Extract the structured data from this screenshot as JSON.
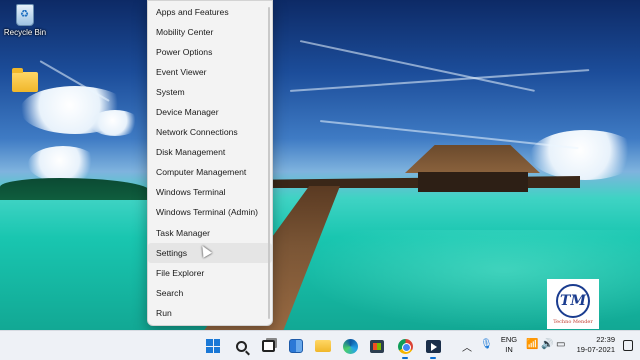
{
  "desktop": {
    "icons": [
      {
        "label": "Recycle Bin",
        "icon": "recycle-bin-icon"
      },
      {
        "label": "",
        "icon": "folder-icon"
      }
    ]
  },
  "winx_menu": {
    "items": [
      "Apps and Features",
      "Mobility Center",
      "Power Options",
      "Event Viewer",
      "System",
      "Device Manager",
      "Network Connections",
      "Disk Management",
      "Computer Management",
      "Windows Terminal",
      "Windows Terminal (Admin)",
      "Task Manager",
      "Settings",
      "File Explorer",
      "Search",
      "Run"
    ],
    "hovered": "Settings"
  },
  "watermark": {
    "monogram": "TM",
    "text": "Techno Mender"
  },
  "taskbar": {
    "apps": [
      {
        "name": "Start",
        "icon": "windows-start-icon"
      },
      {
        "name": "Search",
        "icon": "search-icon"
      },
      {
        "name": "Task View",
        "icon": "task-view-icon"
      },
      {
        "name": "Widgets",
        "icon": "widgets-icon"
      },
      {
        "name": "File Explorer",
        "icon": "folder-icon"
      },
      {
        "name": "Microsoft Edge",
        "icon": "edge-icon"
      },
      {
        "name": "Microsoft Store",
        "icon": "store-icon"
      },
      {
        "name": "Google Chrome",
        "icon": "chrome-icon"
      },
      {
        "name": "Screen Recorder",
        "icon": "recorder-icon"
      }
    ],
    "tray": {
      "language_line1": "ENG",
      "language_line2": "IN",
      "time": "22:39",
      "date": "19-07-2021"
    }
  },
  "colors": {
    "accent": "#1a78d6",
    "menu_bg": "#f3f3f3",
    "taskbar_bg": "#eef1f6"
  }
}
